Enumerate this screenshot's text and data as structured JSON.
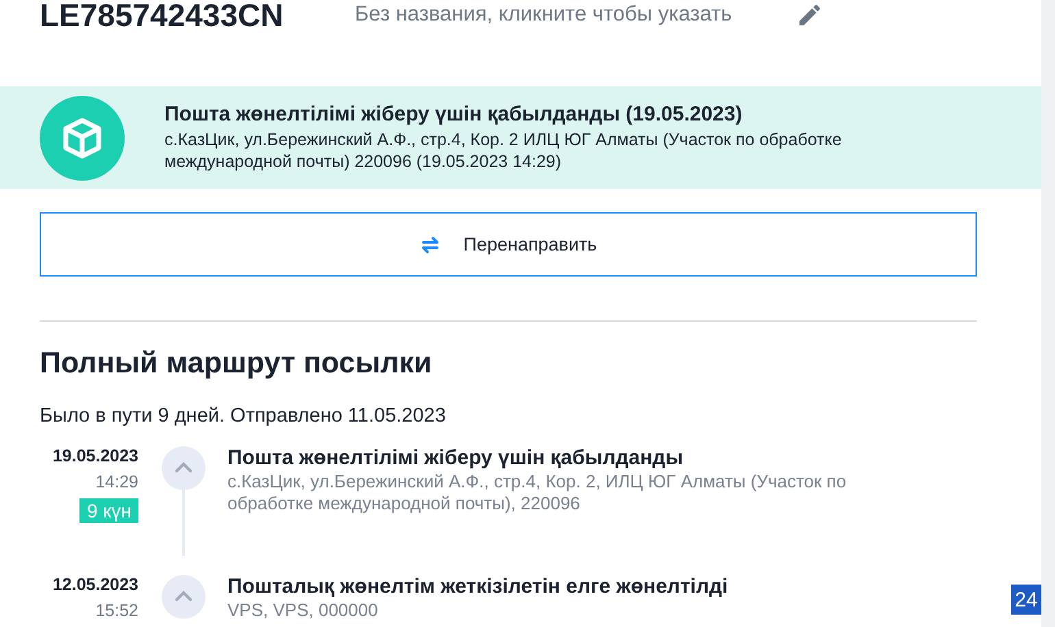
{
  "tracking_number": "LE785742433CN",
  "name_placeholder": "Без названия, кликните чтобы указать",
  "status_banner": {
    "title": "Пошта жөнелтілімі жіберу үшін қабылданды (19.05.2023)",
    "details": "с.КазЦик, ул.Бережинский А.Ф., стр.4, Кор. 2 ИЛЦ ЮГ Алматы (Участок по обработке международной почты) 220096 (19.05.2023 14:29)"
  },
  "redirect_button": "Перенаправить",
  "route": {
    "heading": "Полный маршрут посылки",
    "summary": "Было в пути 9 дней. Отправлено 11.05.2023",
    "events": [
      {
        "date": "19.05.2023",
        "time": "14:29",
        "badge": "9 күн",
        "title": "Пошта жөнелтілімі жіберу үшін қабылданды",
        "details": "с.КазЦик, ул.Бережинский А.Ф., стр.4, Кор. 2, ИЛЦ ЮГ Алматы (Участок по обработке международной почты), 220096"
      },
      {
        "date": "12.05.2023",
        "time": "15:52",
        "title": "Пошталық жөнелтім жеткізілетін елге жөнелтілді",
        "details": "VPS, VPS, 000000"
      }
    ]
  },
  "corner_badge": "24"
}
